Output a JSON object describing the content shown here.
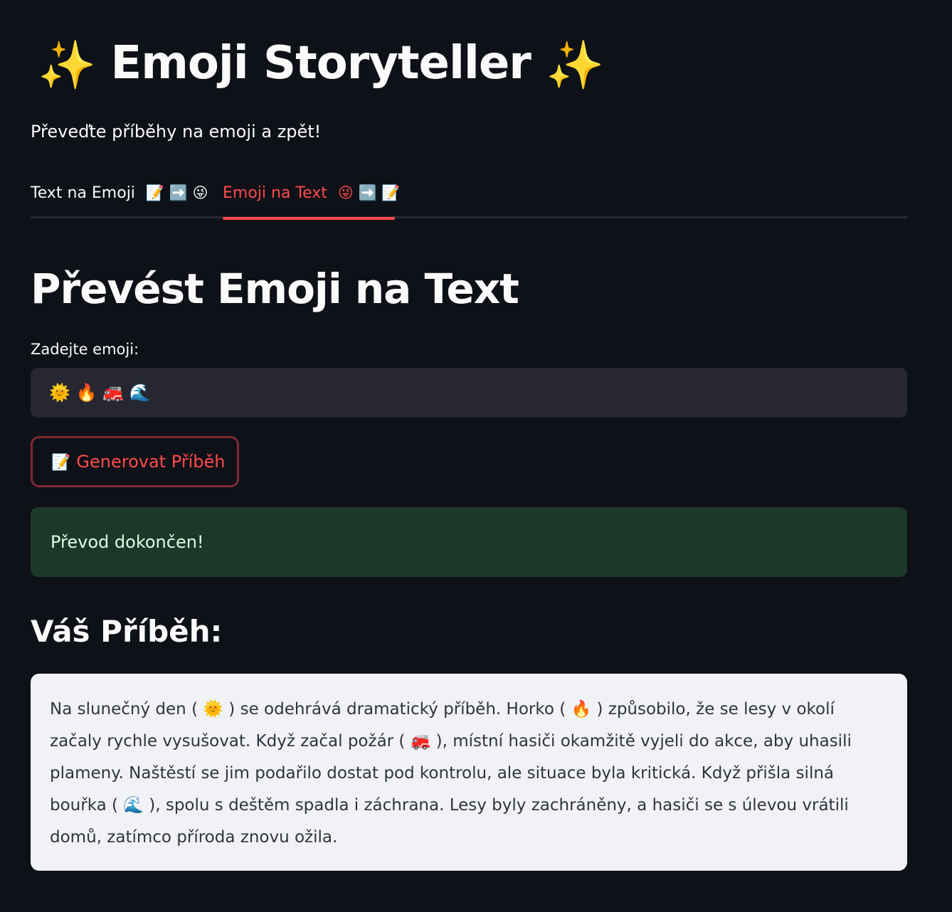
{
  "header": {
    "title": "Emoji Storyteller",
    "sparkle_icon": "✨",
    "subtitle": "Převeďte příběhy na emoji a zpět!"
  },
  "tabs": [
    {
      "label": "Text na Emoji",
      "icons": "📝 ➡️ 😜",
      "active": false
    },
    {
      "label": "Emoji na Text",
      "icons": "😜 ➡️ 📝",
      "active": true
    }
  ],
  "main": {
    "section_title": "Převést Emoji na Text",
    "input_label": "Zadejte emoji:",
    "input_value": "🌞 🔥 🚒 🌊",
    "button_icon": "📝",
    "button_label": "Generovat Příběh",
    "success_message": "Převod dokončen!",
    "story_heading": "Váš Příběh:",
    "story_text": "Na slunečný den ( 🌞 ) se odehrává dramatický příběh. Horko ( 🔥 ) způsobilo, že se lesy v okolí začaly rychle vysušovat. Když začal požár ( 🚒 ), místní hasiči okamžitě vyjeli do akce, aby uhasili plameny. Naštěstí se jim podařilo dostat pod kontrolu, ale situace byla kritická. Když přišla silná bouřka ( 🌊 ), spolu s deštěm spadla i záchrana. Lesy byly zachráněny, a hasiči se s úlevou vrátili domů, zatímco příroda znovu ožila."
  },
  "colors": {
    "background": "#0e1117",
    "accent": "#ff4b4b",
    "input_bg": "#262730",
    "success_bg": "#1c3828",
    "story_bg": "#f0f2f6"
  }
}
